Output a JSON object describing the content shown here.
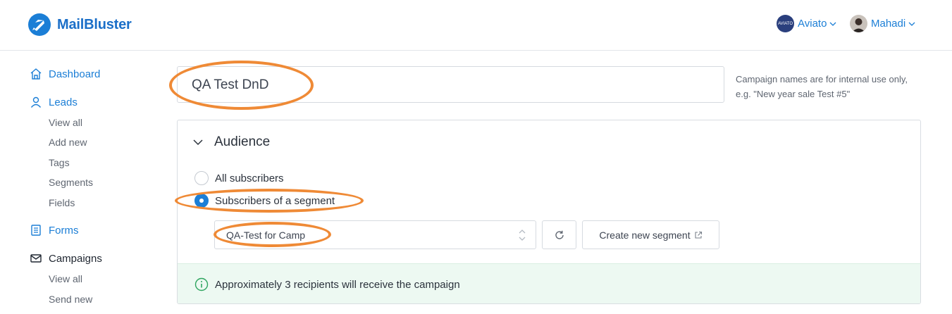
{
  "header": {
    "brand": "MailBluster",
    "org_name": "Aviato",
    "org_avatar_text": "AVIATO",
    "user_name": "Mahadi"
  },
  "sidebar": {
    "dashboard": "Dashboard",
    "leads": "Leads",
    "leads_items": [
      "View all",
      "Add new",
      "Tags",
      "Segments",
      "Fields"
    ],
    "forms": "Forms",
    "campaigns": "Campaigns",
    "campaigns_items": [
      "View all",
      "Send new"
    ]
  },
  "campaign": {
    "name_value": "QA Test DnD",
    "helper_line1": "Campaign names are for internal use only,",
    "helper_line2": "e.g. \"New year sale Test #5\""
  },
  "audience": {
    "title": "Audience",
    "option_all": "All subscribers",
    "option_segment": "Subscribers of a segment",
    "selected_option": "segment",
    "segment_value": "QA-Test for Camp",
    "create_segment_label": "Create new segment",
    "notice": "Approximately 3 recipients will receive the campaign"
  },
  "icons": {
    "logo": "rocket-icon",
    "dashboard": "home-icon",
    "leads": "user-icon",
    "forms": "form-icon",
    "campaigns": "envelope-icon",
    "refresh": "refresh-icon",
    "external": "external-link-icon",
    "info": "info-icon"
  },
  "colors": {
    "brand": "#1b7ed6",
    "notice_bg": "#edf9f2",
    "annotation": "#ef8a36"
  }
}
